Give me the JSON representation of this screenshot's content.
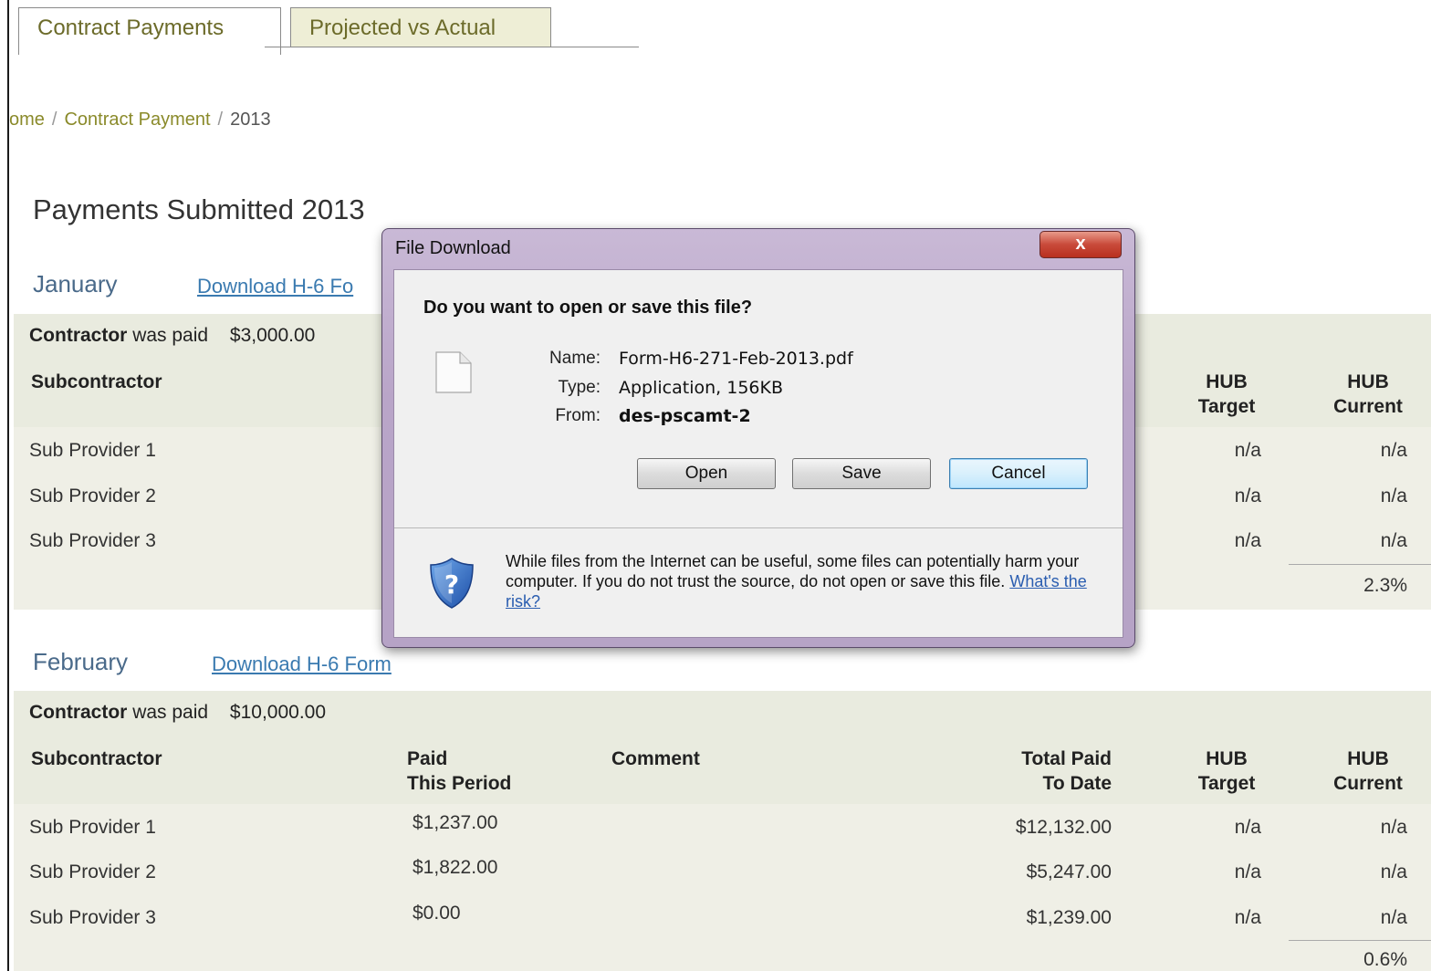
{
  "tabs": [
    {
      "label": "Contract Payments",
      "active": true
    },
    {
      "label": "Projected vs Actual",
      "active": false
    }
  ],
  "breadcrumb": {
    "home": "ome",
    "contract_payment": "Contract Payment",
    "year": "2013",
    "separator": "/"
  },
  "page_title": "Payments Submitted 2013",
  "headers": {
    "subcontractor": "Subcontractor",
    "paid_line1": "Paid",
    "paid_line2": "This Period",
    "comment": "Comment",
    "total_line1": "Total Paid",
    "total_line2": "To Date",
    "hub_target_line1": "HUB",
    "hub_target_line2": "Target",
    "hub_current_line1": "HUB",
    "hub_current_line2": "Current"
  },
  "january": {
    "month": "January",
    "download_label": "Download H-6 Fo",
    "contractor_label": "Contractor",
    "was_paid": "was paid",
    "amount": "$3,000.00",
    "rows": [
      {
        "name": "Sub Provider 1",
        "hub_target": "n/a",
        "hub_current": "n/a"
      },
      {
        "name": "Sub Provider 2",
        "hub_target": "n/a",
        "hub_current": "n/a"
      },
      {
        "name": "Sub Provider 3",
        "hub_target": "n/a",
        "hub_current": "n/a"
      }
    ],
    "hub_total": "2.3%"
  },
  "february": {
    "month": "February",
    "download_label": "Download H-6 Form",
    "contractor_label": "Contractor",
    "was_paid": "was paid",
    "amount": "$10,000.00",
    "rows": [
      {
        "name": "Sub Provider 1",
        "paid": "$1,237.00",
        "total": "$12,132.00",
        "hub_target": "n/a",
        "hub_current": "n/a"
      },
      {
        "name": "Sub Provider 2",
        "paid": "$1,822.00",
        "total": "$5,247.00",
        "hub_target": "n/a",
        "hub_current": "n/a"
      },
      {
        "name": "Sub Provider 3",
        "paid": "$0.00",
        "total": "$1,239.00",
        "hub_target": "n/a",
        "hub_current": "n/a"
      }
    ],
    "hub_total": "0.6%"
  },
  "dialog": {
    "title": "File Download",
    "close_symbol": "x",
    "question": "Do you want to open or save this file?",
    "name_label": "Name:",
    "name_value": "Form-H6-271-Feb-2013.pdf",
    "type_label": "Type:",
    "type_value": "Application, 156KB",
    "from_label": "From:",
    "from_value": "des-pscamt-2",
    "open_label": "Open",
    "save_label": "Save",
    "cancel_label": "Cancel",
    "warning_text": "While files from the Internet can be useful, some files can potentially harm your computer. If you do not trust the source, do not open or save this file.",
    "risk_link": "What's the risk?"
  },
  "colors": {
    "accent_olive": "#8a8a2a",
    "link_blue": "#3a7ab0",
    "panel_bg": "#e9ebdf"
  }
}
